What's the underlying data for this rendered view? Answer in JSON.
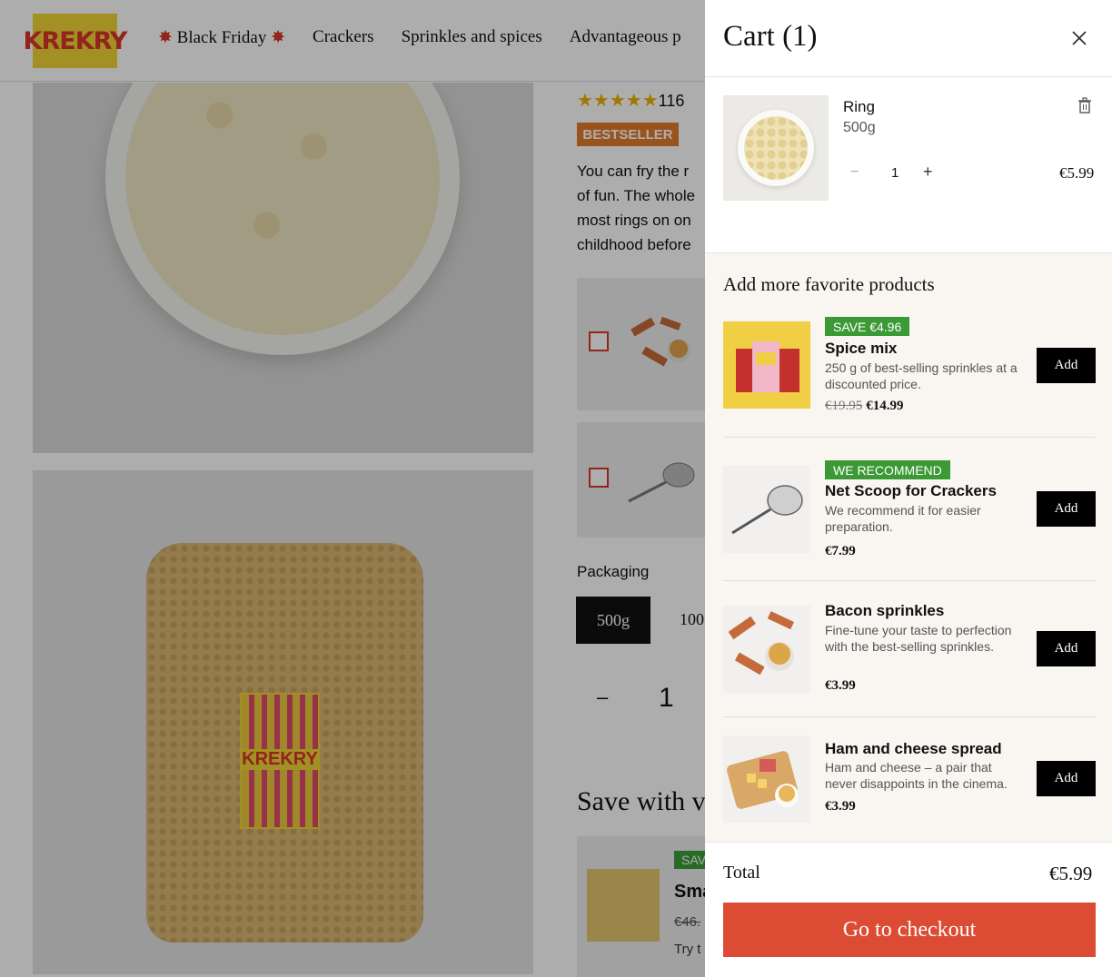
{
  "brand": {
    "logo_text": "KREKRY"
  },
  "nav": {
    "items": [
      {
        "label": "Black Friday",
        "has_star": true
      },
      {
        "label": "Crackers"
      },
      {
        "label": "Sprinkles and spices"
      },
      {
        "label": "Advantageous p"
      }
    ]
  },
  "product": {
    "rating_count": "116",
    "badge": "BESTSELLER",
    "description": [
      "You can fry the r",
      "of fun. The whole",
      "most rings on on",
      "childhood before"
    ],
    "packaging_label": "Packaging",
    "pack_options": [
      "500g",
      "100"
    ],
    "quantity_minus": "–",
    "quantity": "1",
    "save_heading": "Save with va",
    "bundle": {
      "tag": "SAV",
      "title": "Sma",
      "price_old": "€46.",
      "desc": "Try t"
    },
    "bag_label": "KREKRY"
  },
  "cart": {
    "title": "Cart (1)",
    "item": {
      "name": "Ring",
      "size": "500g",
      "quantity": "1",
      "price": "€5.99",
      "minus": "−",
      "plus": "+"
    },
    "recs_title": "Add more favorite products",
    "recs": [
      {
        "tag": "SAVE €4.96",
        "title": "Spice mix",
        "desc": "250 g of best-selling sprinkles at a discounted price.",
        "price_old": "€19.95",
        "price": "€14.99",
        "add": "Add"
      },
      {
        "tag": "WE RECOMMEND",
        "title": "Net Scoop for Crackers",
        "desc": "We recommend it for easier preparation.",
        "price": "€7.99",
        "add": "Add"
      },
      {
        "title": "Bacon sprinkles",
        "desc": "Fine-tune your taste to perfection with the best-selling sprinkles.",
        "price": "€3.99",
        "add": "Add"
      },
      {
        "title": "Ham and cheese spread",
        "desc": "Ham and cheese – a pair that never disappoints in the cinema.",
        "price": "€3.99",
        "add": "Add"
      }
    ],
    "total_label": "Total",
    "total_value": "€5.99",
    "checkout_label": "Go to checkout"
  },
  "colors": {
    "accent": "#dc4b33",
    "tag_green": "#3b9a35",
    "logo_yellow": "#f1d437",
    "logo_red": "#d6372a"
  }
}
